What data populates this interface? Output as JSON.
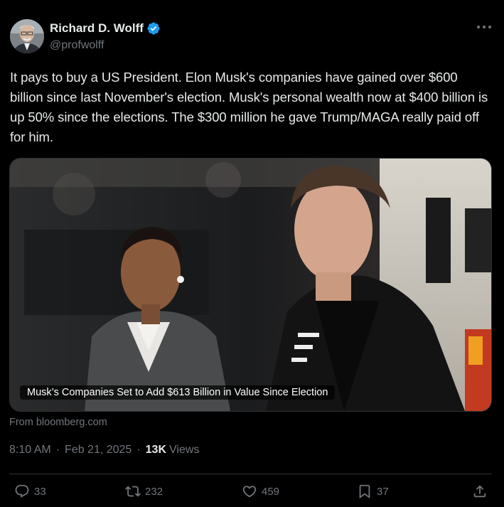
{
  "author": {
    "display_name": "Richard D. Wolff",
    "handle": "@profwolff",
    "verified": true
  },
  "post": {
    "text": "It pays to buy a US President. Elon Musk's companies have gained over $600 billion since last November's election. Musk's personal wealth now at $400 billion is up 50% since the elections. The $300 million he gave Trump/MAGA really paid off for him.",
    "media_caption": "Musk’s Companies Set to Add $613 Billion in Value Since Election",
    "source": "From bloomberg.com",
    "time": "8:10 AM",
    "date": "Feb 21, 2025",
    "views_count": "13K",
    "views_label": "Views",
    "separator": "·"
  },
  "actions": {
    "replies": "33",
    "reposts": "232",
    "likes": "459",
    "bookmarks": "37"
  },
  "icons": {
    "more": "more-dots-icon",
    "verified": "verified-badge-icon",
    "reply": "reply-bubble-icon",
    "repost": "repost-arrows-icon",
    "like": "heart-icon",
    "bookmark": "bookmark-icon",
    "share": "share-upload-icon"
  },
  "colors": {
    "background": "#000000",
    "text": "#e7e9ea",
    "muted": "#71767b",
    "border": "#2f3336",
    "verified": "#1d9bf0"
  }
}
